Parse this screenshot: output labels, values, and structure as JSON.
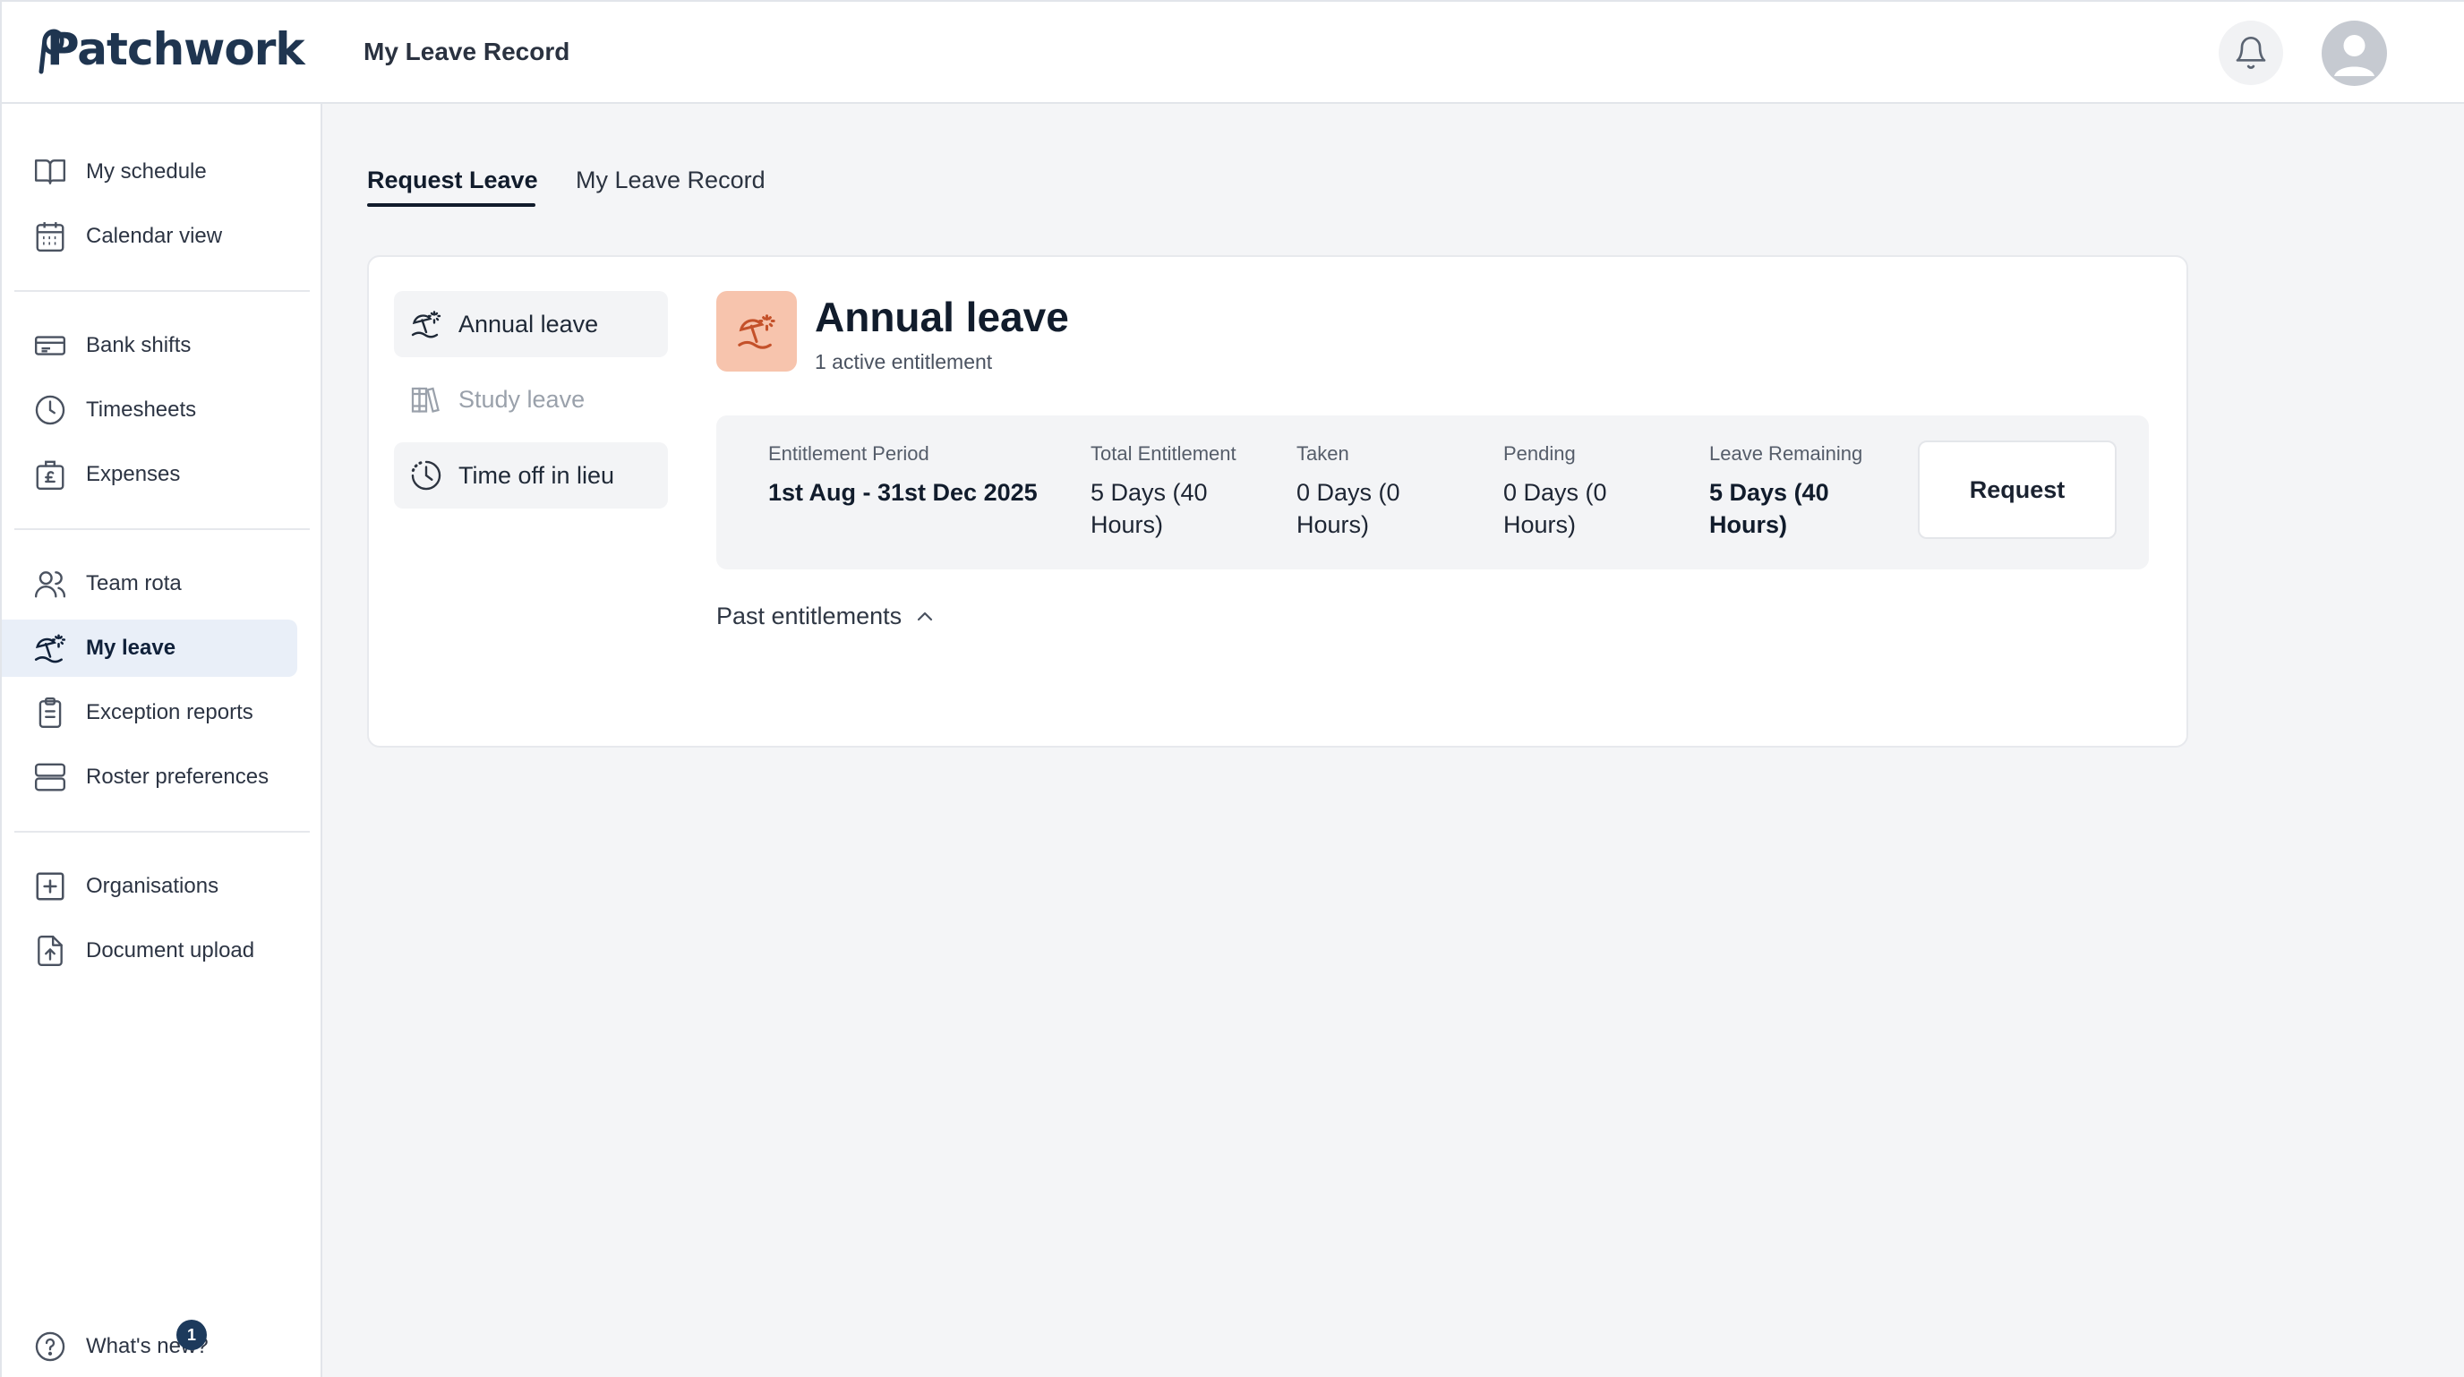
{
  "header": {
    "logo_text": "Patchwork",
    "page_title": "My Leave Record",
    "icons": {
      "notifications": "bell-icon",
      "profile": "user-avatar-icon"
    }
  },
  "sidebar": {
    "items": [
      {
        "label": "My schedule",
        "icon": "book-icon"
      },
      {
        "label": "Calendar view",
        "icon": "calendar-icon"
      },
      {
        "label": "Bank shifts",
        "icon": "ticket-icon"
      },
      {
        "label": "Timesheets",
        "icon": "clock-icon"
      },
      {
        "label": "Expenses",
        "icon": "pound-bag-icon"
      },
      {
        "label": "Team rota",
        "icon": "users-icon"
      },
      {
        "label": "My leave",
        "icon": "beach-umbrella-icon",
        "active": true
      },
      {
        "label": "Exception reports",
        "icon": "clipboard-icon"
      },
      {
        "label": "Roster preferences",
        "icon": "layout-rows-icon"
      },
      {
        "label": "Organisations",
        "icon": "plus-square-icon"
      },
      {
        "label": "Document upload",
        "icon": "file-upload-icon"
      }
    ],
    "whats_new": {
      "label": "What's new?",
      "badge": "1",
      "icon": "help-circle-icon"
    }
  },
  "tabs": [
    {
      "label": "Request Leave",
      "active": true
    },
    {
      "label": "My Leave Record",
      "active": false
    }
  ],
  "leave_types": [
    {
      "label": "Annual leave",
      "selected": true,
      "disabled": false,
      "icon": "beach-umbrella-icon"
    },
    {
      "label": "Study leave",
      "selected": false,
      "disabled": true,
      "icon": "books-icon"
    },
    {
      "label": "Time off in lieu",
      "selected": false,
      "disabled": false,
      "icon": "clock-dashed-icon"
    }
  ],
  "detail": {
    "title": "Annual leave",
    "subtitle": "1 active entitlement",
    "entitlement": {
      "period_label": "Entitlement Period",
      "period_value": "1st Aug - 31st Dec 2025",
      "total_label": "Total Entitlement",
      "total_value": "5 Days (40 Hours)",
      "taken_label": "Taken",
      "taken_value": "0 Days (0 Hours)",
      "pending_label": "Pending",
      "pending_value": "0 Days (0 Hours)",
      "remaining_label": "Leave Remaining",
      "remaining_value": "5 Days (40 Hours)"
    },
    "request_button": "Request",
    "past_entitlements": "Past entitlements"
  },
  "colors": {
    "brand": "#1f3550",
    "accent_leave_bg": "#f7c4ad",
    "accent_leave_icon": "#c4512a",
    "active_nav_bg": "#e9eff8",
    "badge": "#1d3a5c"
  }
}
